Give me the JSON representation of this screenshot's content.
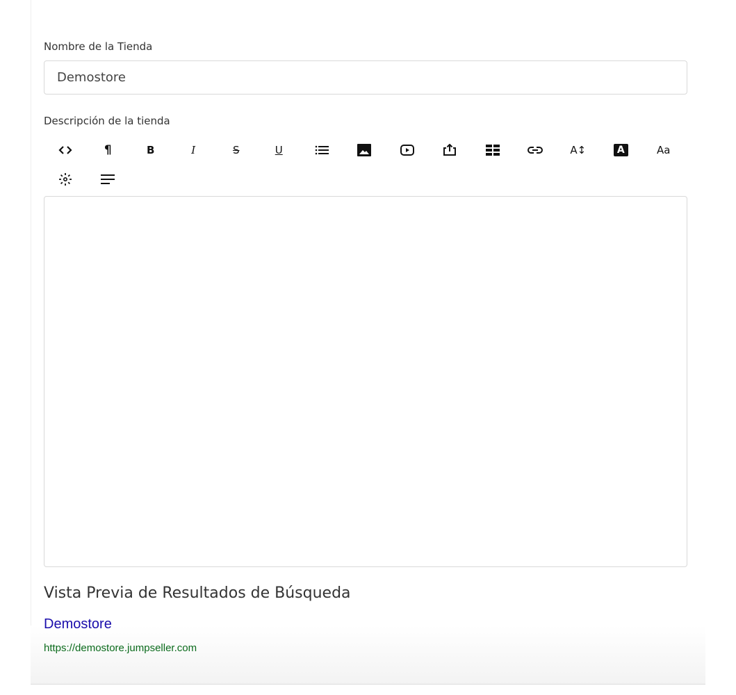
{
  "form": {
    "store_name_label": "Nombre de la Tienda",
    "store_name_value": "Demostore",
    "description_label": "Descripción de la tienda"
  },
  "toolbar": {
    "row1": [
      {
        "icon": "code-view-icon"
      },
      {
        "icon": "paragraph-icon",
        "text": "¶"
      },
      {
        "icon": "bold-icon",
        "text": "B"
      },
      {
        "icon": "italic-icon",
        "text": "I"
      },
      {
        "icon": "strikethrough-icon",
        "text": "S"
      },
      {
        "icon": "underline-icon",
        "text": "U"
      },
      {
        "icon": "list-icon"
      },
      {
        "icon": "image-icon"
      },
      {
        "icon": "video-icon"
      },
      {
        "icon": "file-upload-icon"
      },
      {
        "icon": "table-icon"
      },
      {
        "icon": "link-icon"
      },
      {
        "icon": "font-size-icon",
        "text": "A↕"
      },
      {
        "icon": "font-color-icon",
        "text": "A"
      },
      {
        "icon": "font-family-icon",
        "text": "Aa"
      }
    ],
    "row2": [
      {
        "icon": "line-height-icon"
      },
      {
        "icon": "align-icon"
      }
    ]
  },
  "preview": {
    "title": "Vista Previa de Resultados de Búsqueda",
    "link_text": "Demostore",
    "url": "https://demostore.jumpseller.com"
  },
  "colors": {
    "link": "#1a0dab",
    "url": "#0b6b1c",
    "border": "#d9d9d9"
  }
}
